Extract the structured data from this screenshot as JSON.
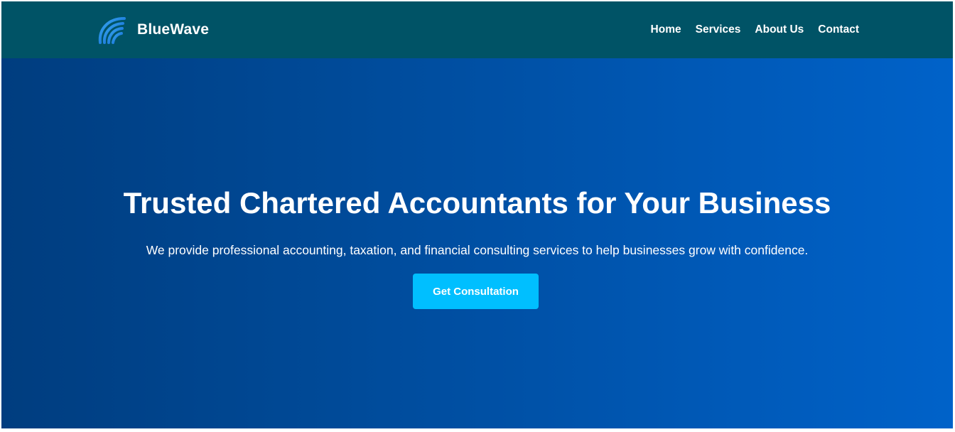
{
  "navbar": {
    "brand": "BlueWave",
    "logo_icon": "wave-logo-icon",
    "links": [
      "Home",
      "Services",
      "About Us",
      "Contact"
    ],
    "background": "#005366"
  },
  "hero": {
    "title": "Trusted Chartered Accountants for Your Business",
    "subtitle": "We provide professional accounting, taxation, and financial consulting services to help businesses grow with confidence.",
    "cta_label": "Get Consultation",
    "gradient": [
      "#003d7f",
      "#0062c9"
    ],
    "cta_color": "#00bfff"
  }
}
